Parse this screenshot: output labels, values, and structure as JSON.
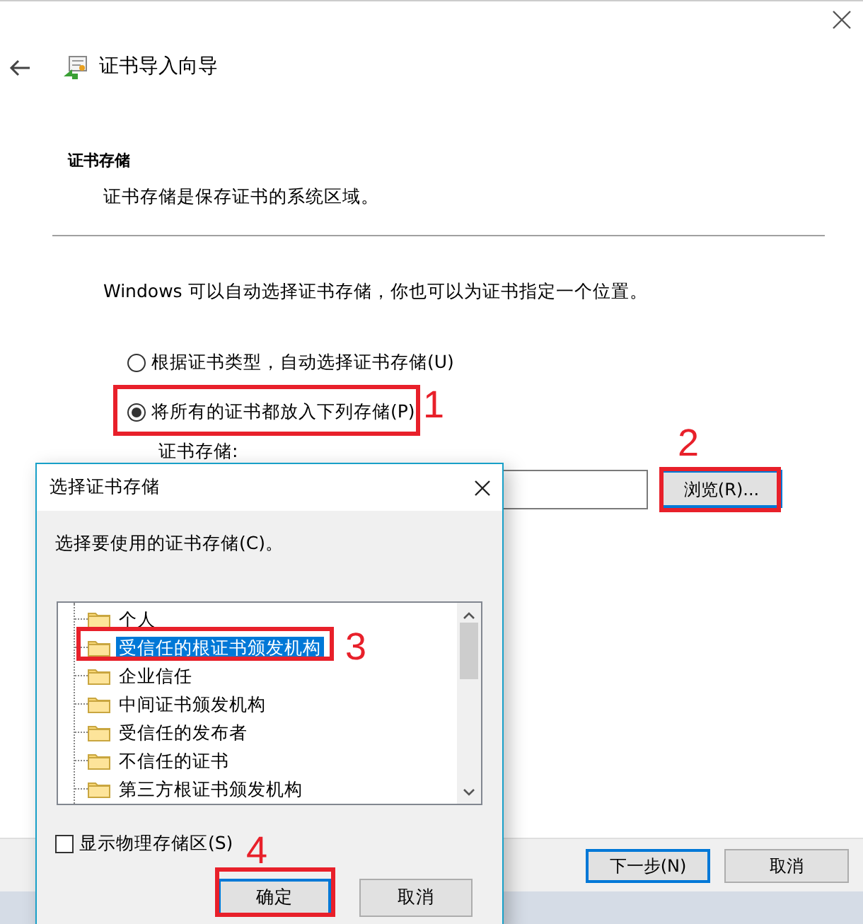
{
  "wizard": {
    "title": "证书导入向导",
    "section_title": "证书存储",
    "section_description": "证书存储是保存证书的系统区域。",
    "intro": "Windows 可以自动选择证书存储，你也可以为证书指定一个位置。",
    "options": [
      {
        "label": "根据证书类型，自动选择证书存储(U)",
        "selected": false
      },
      {
        "label": "将所有的证书都放入下列存储(P)",
        "selected": true
      }
    ],
    "store_label": "证书存储:",
    "browse_button": "浏览(R)...",
    "buttons": [
      {
        "label": "下一步(N)",
        "default": true
      },
      {
        "label": "取消",
        "default": false
      }
    ]
  },
  "dialog": {
    "title": "选择证书存储",
    "prompt": "选择要使用的证书存储(C)。",
    "stores": [
      {
        "label": "个人",
        "selected": false
      },
      {
        "label": "受信任的根证书颁发机构",
        "selected": true
      },
      {
        "label": "企业信任",
        "selected": false
      },
      {
        "label": "中间证书颁发机构",
        "selected": false
      },
      {
        "label": "受信任的发布者",
        "selected": false
      },
      {
        "label": "不信任的证书",
        "selected": false
      },
      {
        "label": "第三方根证书颁发机构",
        "selected": false
      }
    ],
    "show_physical": {
      "label": "显示物理存储区(S)",
      "checked": false
    },
    "buttons": [
      {
        "label": "确定",
        "default": true
      },
      {
        "label": "取消",
        "default": false
      }
    ]
  },
  "annotations": [
    {
      "label": "1"
    },
    {
      "label": "2"
    },
    {
      "label": "3"
    },
    {
      "label": "4"
    }
  ]
}
